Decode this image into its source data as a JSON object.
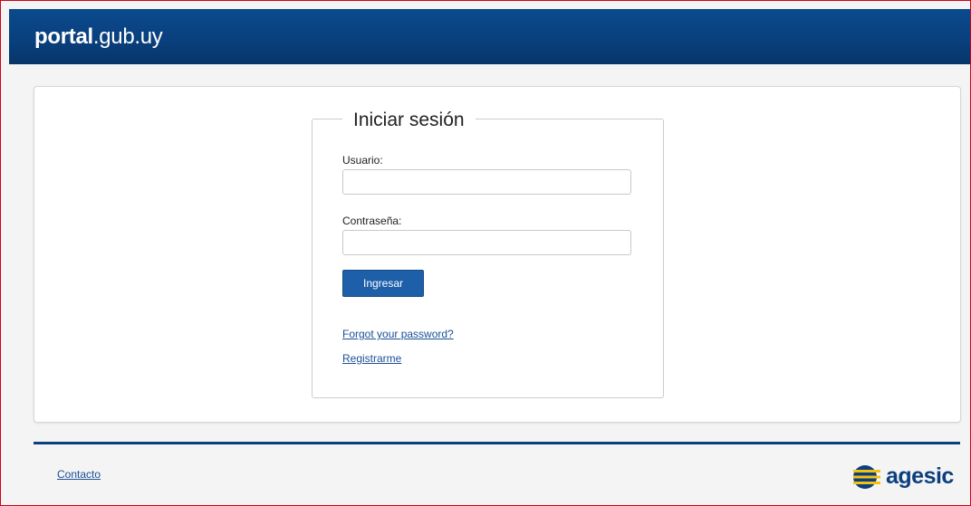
{
  "header": {
    "brand_bold": "portal",
    "brand_rest": ".gub.uy"
  },
  "login": {
    "title": "Iniciar sesión",
    "username_label": "Usuario:",
    "username_value": "",
    "password_label": "Contraseña:",
    "password_value": "",
    "submit_label": "Ingresar",
    "forgot_link": "Forgot your password?",
    "register_link": "Registrarme"
  },
  "footer": {
    "contact_link": "Contacto",
    "logo_text": "agesic",
    "logo_icon": "agesic-logo-icon"
  },
  "colors": {
    "header_bg": "#093f7c",
    "button_bg": "#1d5fa8",
    "link": "#1b4f96",
    "logo": "#0b3f7e",
    "logo_accent": "#f4c20d",
    "frame_border": "#d0021b"
  }
}
